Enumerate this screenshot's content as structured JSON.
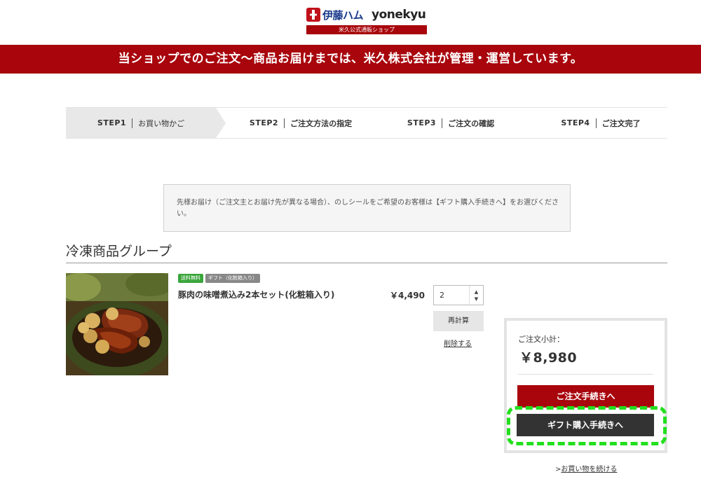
{
  "header": {
    "brand_jp": "伊藤ハム",
    "brand_en": "yonekyu",
    "sub_label": "米久公式通販ショップ",
    "banner": "当ショップでのご注文〜商品お届けまでは、米久株式会社が管理・運営しています。"
  },
  "steps": [
    {
      "num": "STEP1",
      "label": "お買い物かご",
      "active": true
    },
    {
      "num": "STEP2",
      "label": "ご注文方法の指定"
    },
    {
      "num": "STEP3",
      "label": "ご注文の確認"
    },
    {
      "num": "STEP4",
      "label": "ご注文完了"
    }
  ],
  "notice": "先様お届け（ご注文主とお届け先が異なる場合）、のしシールをご希望のお客様は【ギフト購入手続きへ】をお選びください。",
  "group_title": "冷凍商品グループ",
  "product": {
    "badge_free": "送料無料",
    "badge_gift": "ギフト（化粧箱入り）",
    "name": "豚肉の味噌煮込み2本セット(化粧箱入り)",
    "price": "￥4,490",
    "quantity": "2",
    "recalc_label": "再計算",
    "delete_label": "削除する"
  },
  "summary": {
    "subtotal_label": "ご注文小計：",
    "subtotal_value": "￥8,980",
    "order_button": "ご注文手続きへ",
    "gift_button": "ギフト購入手続きへ"
  },
  "continue_prefix": ">",
  "continue_label": "お買い物を続ける",
  "colors": {
    "brand_red": "#a8050c",
    "dark_button": "#333333",
    "highlight": "#22e01d"
  }
}
